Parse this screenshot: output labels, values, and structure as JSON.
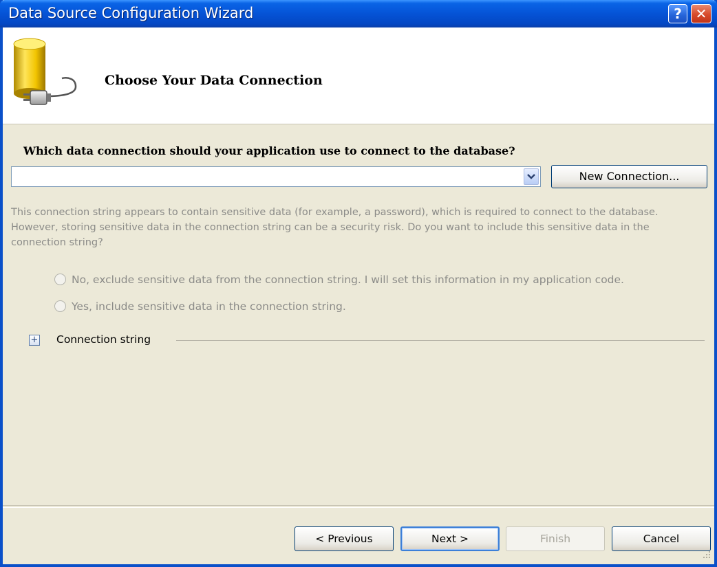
{
  "window": {
    "title": "Data Source Configuration Wizard",
    "help_glyph": "?",
    "close_glyph": "✕"
  },
  "header": {
    "title": "Choose Your Data Connection",
    "icon": "database-connection-icon"
  },
  "connection": {
    "question": "Which data connection should your application use to connect to the database?",
    "selected_value": "",
    "new_connection_label": "New Connection..."
  },
  "sensitive": {
    "info": "This connection string appears to contain sensitive data (for example, a password), which is required to connect to the database. However, storing sensitive data in the connection string can be a security risk. Do you want to include this sensitive data in the connection string?",
    "option_exclude": "No, exclude sensitive data from the connection string. I will set this information in my application code.",
    "option_include": "Yes, include sensitive data in the connection string."
  },
  "connection_string": {
    "label": "Connection string",
    "expander_glyph": "+"
  },
  "footer": {
    "previous_label": "< Previous",
    "next_label": "Next >",
    "finish_label": "Finish",
    "cancel_label": "Cancel"
  },
  "colors": {
    "titlebar": "#0553d6",
    "dialog_bg": "#ece9d8",
    "disabled_text": "#8b8b88"
  }
}
